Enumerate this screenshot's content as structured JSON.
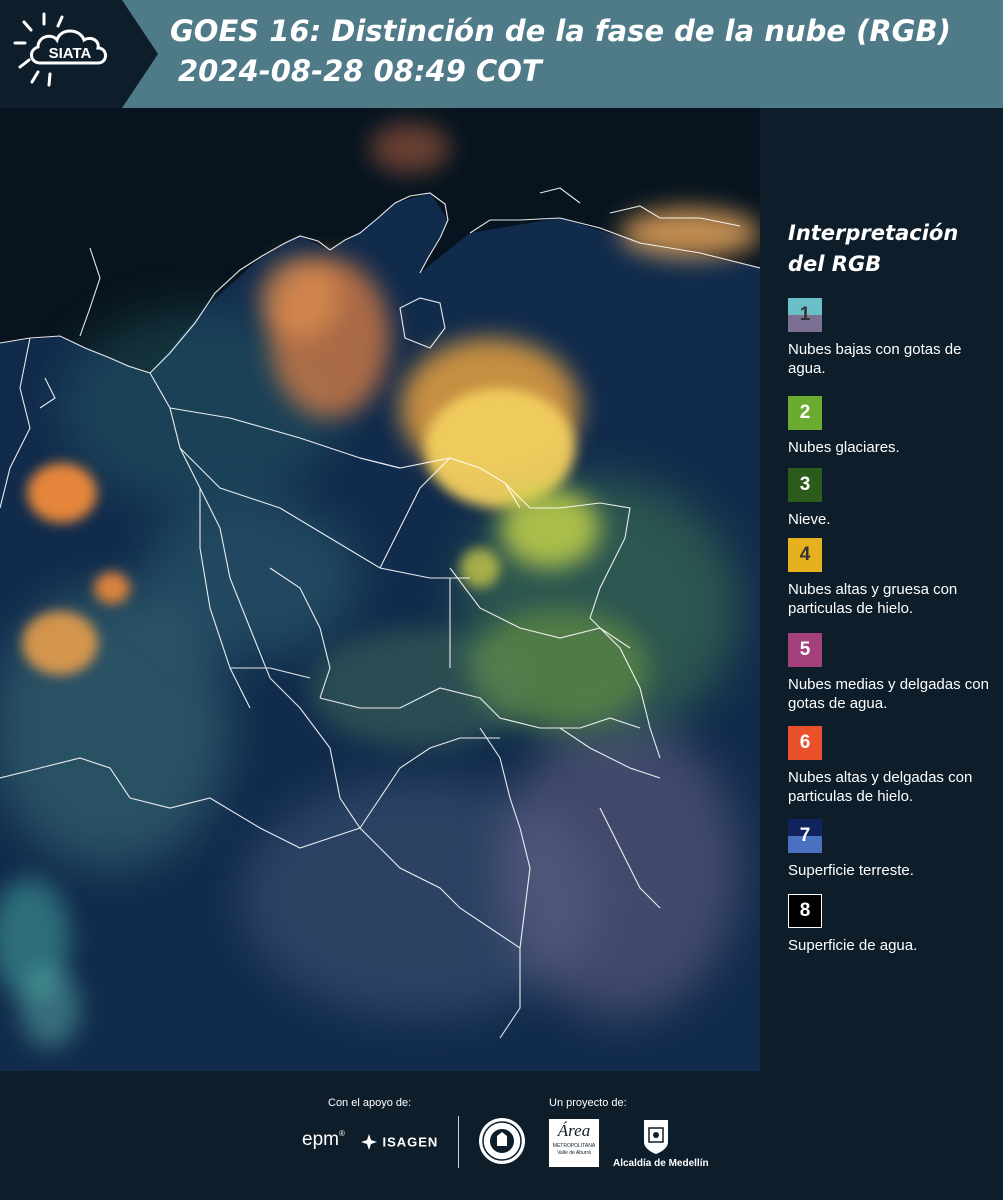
{
  "header": {
    "logo_text": "SIATA",
    "title_line1": "GOES 16: Distinción de la fase de la nube (RGB)",
    "title_line2": "2024-08-28 08:49 COT"
  },
  "legend": {
    "title_line1": "Interpretación",
    "title_line2": "del RGB",
    "items": [
      {
        "num": "1",
        "text": "Nubes bajas con gotas de agua.",
        "color_top": "#6bbfc9",
        "color_bottom": "#7b6f93",
        "num_color": "#333333"
      },
      {
        "num": "2",
        "text": "Nubes glaciares.",
        "color_top": "#6bab2f",
        "color_bottom": "#6bab2f",
        "num_color": "#ffffff"
      },
      {
        "num": "3",
        "text": "Nieve.",
        "color_top": "#2b5c1b",
        "color_bottom": "#2b5c1b",
        "num_color": "#ffffff"
      },
      {
        "num": "4",
        "text": "Nubes altas y gruesa con particulas de hielo.",
        "color_top": "#e7b01f",
        "color_bottom": "#e7b01f",
        "num_color": "#333333"
      },
      {
        "num": "5",
        "text": "Nubes medias y delgadas con gotas de agua.",
        "color_top": "#a4407c",
        "color_bottom": "#a4407c",
        "num_color": "#ffffff"
      },
      {
        "num": "6",
        "text": "Nubes altas y delgadas con particulas de hielo.",
        "color_top": "#e9502b",
        "color_bottom": "#e9502b",
        "num_color": "#ffffff"
      },
      {
        "num": "7",
        "text": "Superficie terreste.",
        "color_top": "#10235e",
        "color_bottom": "#4a70c0",
        "num_color": "#ffffff"
      },
      {
        "num": "8",
        "text": "Superficie de agua.",
        "color_top": "#000000",
        "color_bottom": "#000000",
        "num_color": "#ffffff"
      }
    ]
  },
  "footer": {
    "support_label": "Con el apoyo de:",
    "project_label": "Un proyecto de:",
    "epm": "epm",
    "isagen": "ISAGEN",
    "area_logo_script": "Área",
    "area_logo_line1": "METROPOLITANA",
    "area_logo_line2": "Valle de Aburrá",
    "alcaldia": "Alcaldía de Medellín"
  },
  "colors": {
    "header_bg": "#4f7a88",
    "logo_tab_bg": "#0d1d2a",
    "panel_bg": "#0d1d2a",
    "map_bg": "#07141f"
  }
}
